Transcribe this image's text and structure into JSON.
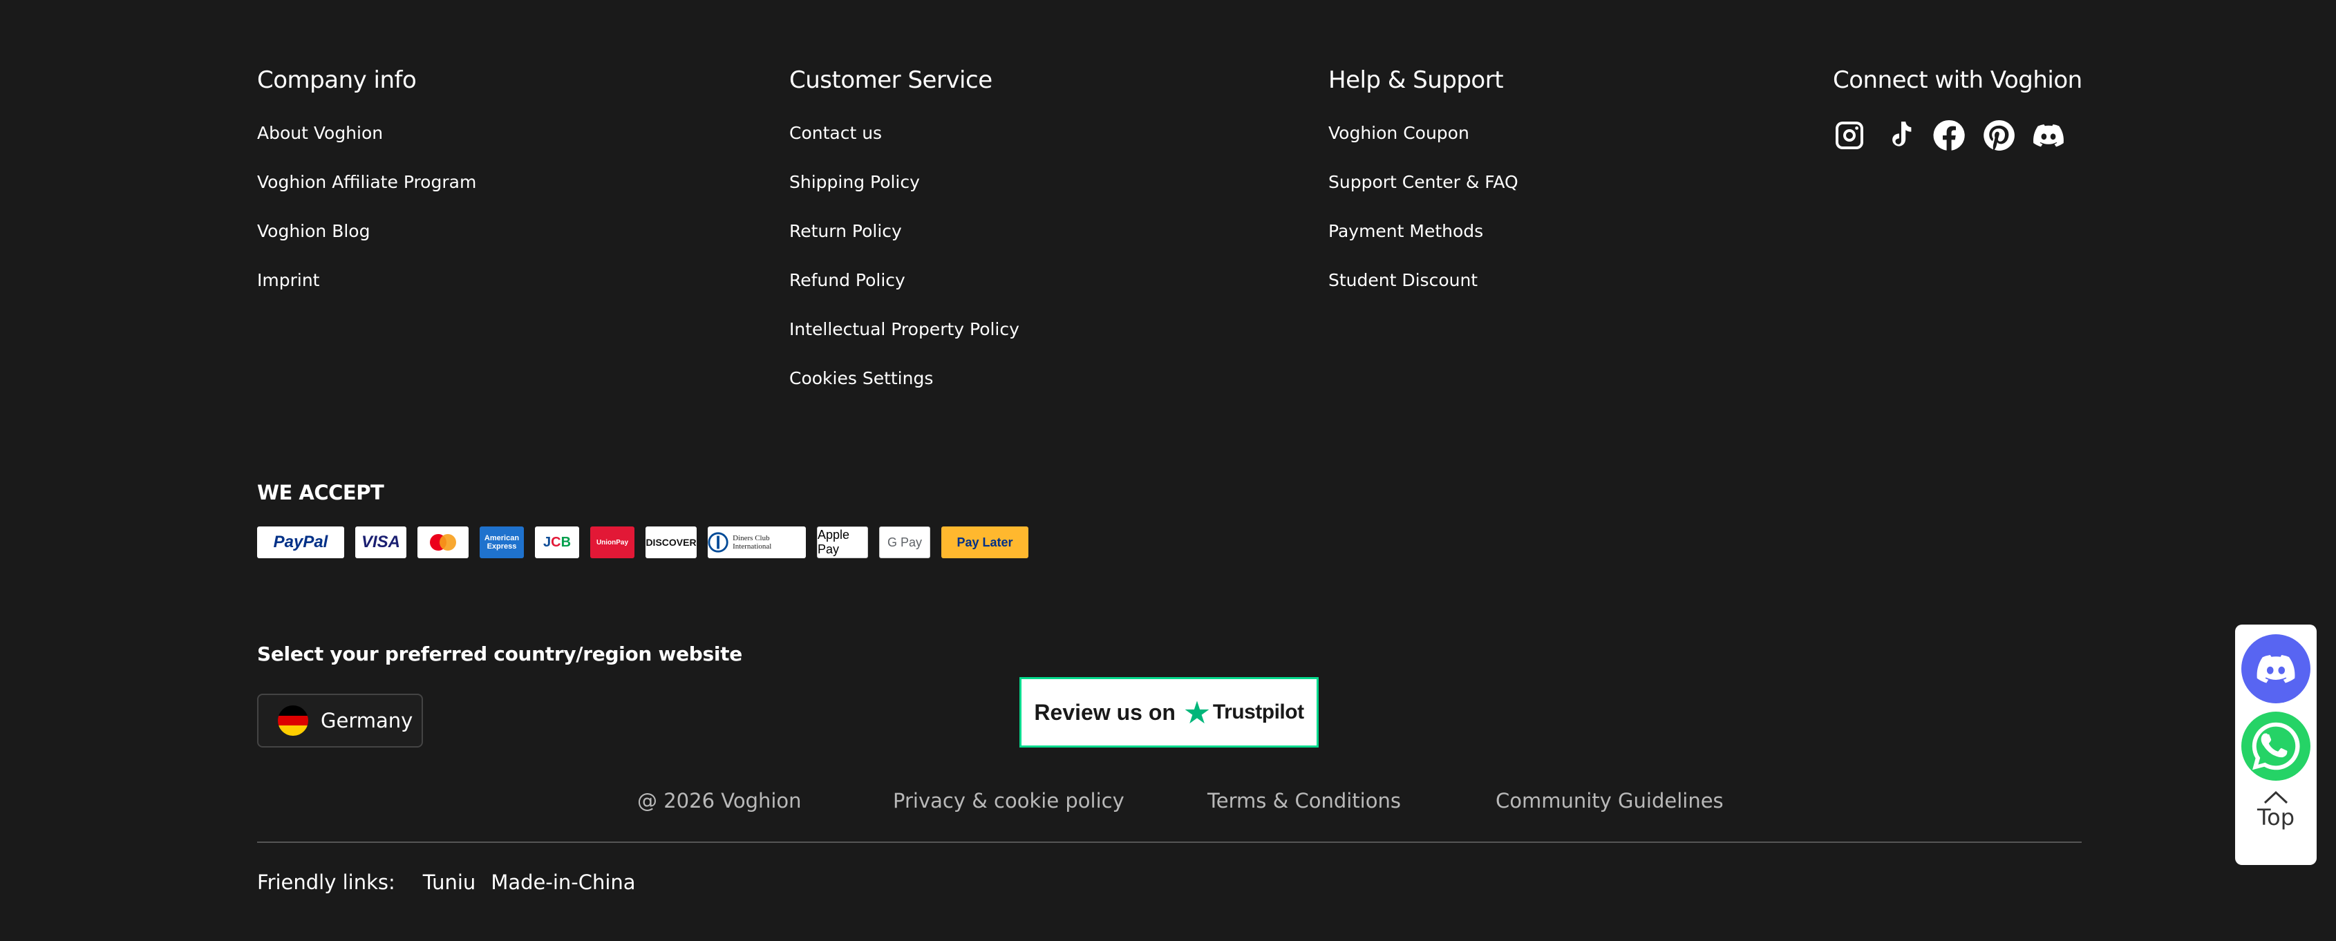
{
  "columns": [
    {
      "title": "Company info",
      "links": [
        "About Voghion",
        "Voghion Affiliate Program",
        "Voghion Blog",
        "Imprint"
      ]
    },
    {
      "title": "Customer Service",
      "links": [
        "Contact us",
        "Shipping Policy",
        "Return Policy",
        "Refund Policy",
        "Intellectual Property Policy",
        "Cookies Settings"
      ]
    },
    {
      "title": "Help & Support",
      "links": [
        "Voghion Coupon",
        "Support Center & FAQ",
        "Payment Methods",
        "Student Discount"
      ]
    },
    {
      "title": "Connect with Voghion",
      "social": [
        "instagram-icon",
        "tiktok-icon",
        "facebook-icon",
        "pinterest-icon",
        "discord-icon"
      ]
    }
  ],
  "payments": {
    "title": "WE ACCEPT",
    "cards": [
      "PayPal",
      "VISA",
      "Mastercard",
      "American Express",
      "JCB",
      "UnionPay",
      "DISCOVER",
      "Diners Club International",
      "Apple Pay",
      "G Pay",
      "Pay Later"
    ]
  },
  "region": {
    "title": "Select your preferred country/region website",
    "selected": "Germany"
  },
  "trustpilot": {
    "review": "Review us on",
    "brand": "Trustpilot",
    "accent": "#00b67a"
  },
  "bottom": {
    "copyright": "@ 2026 Voghion",
    "privacy": "Privacy & cookie policy",
    "terms": "Terms & Conditions",
    "community": "Community Guidelines"
  },
  "friendly": {
    "label": "Friendly links:",
    "links": [
      "Tuniu",
      "Made-in-China"
    ]
  },
  "floating": {
    "top_label": "Top",
    "discord_color": "#5865f2",
    "whatsapp_color": "#25d366"
  }
}
